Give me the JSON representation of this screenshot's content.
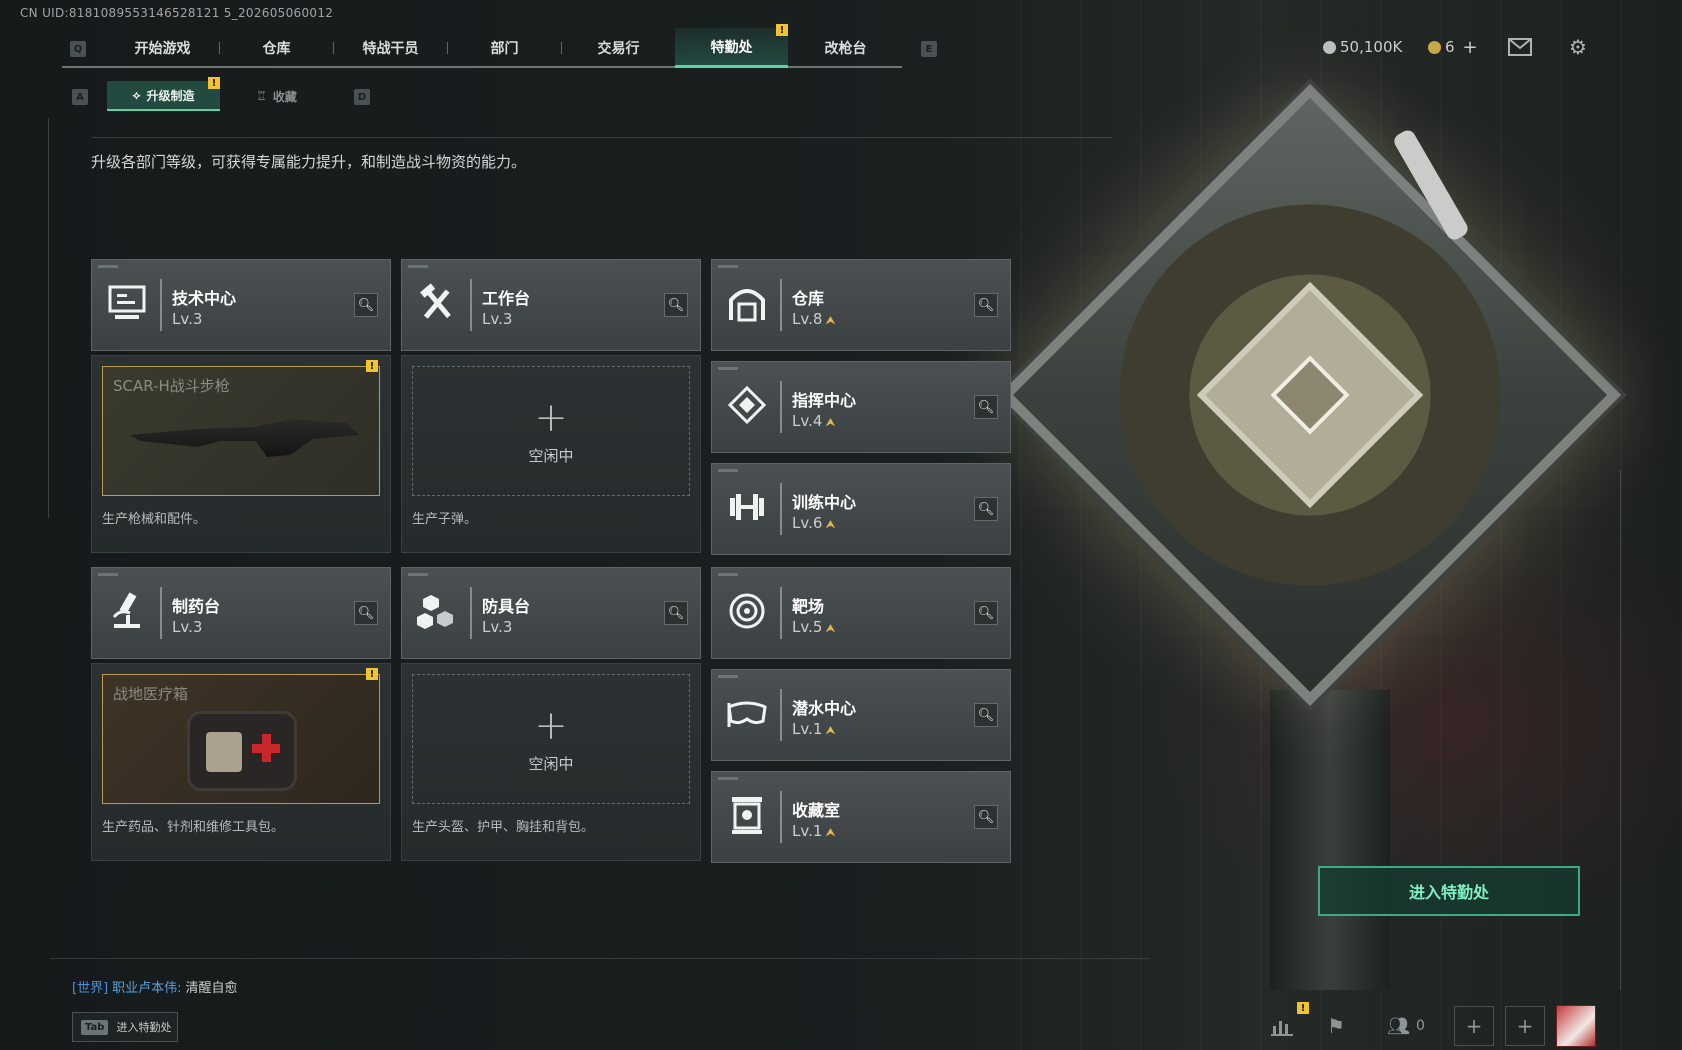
{
  "uid_text": "CN UID:8181089553146528121 5_202605060012",
  "nav": {
    "q_key": "Q",
    "e_key": "E",
    "tabs": [
      "开始游戏",
      "仓库",
      "特战干员",
      "部门",
      "交易行",
      "特勤处",
      "改枪台"
    ],
    "active_tab": "特勤处",
    "alert_mark": "!"
  },
  "currency": {
    "coins": "50,100K",
    "tokens": "6",
    "plus": "+"
  },
  "icons": {
    "mail": "mail-icon",
    "settings": "gear-icon"
  },
  "subnav": {
    "a_key": "A",
    "d_key": "D",
    "tabs": [
      "升级制造",
      "收藏"
    ],
    "active": "升级制造"
  },
  "description": "升级各部门等级，可获得专属能力提升，和制造战斗物资的能力。",
  "departments": [
    {
      "name": "技术中心",
      "level": "Lv.3",
      "icon": "monitor-icon",
      "upgradable": false
    },
    {
      "name": "工作台",
      "level": "Lv.3",
      "icon": "hammer-wrench-icon",
      "upgradable": false
    },
    {
      "name": "仓库",
      "level": "Lv.8",
      "icon": "garage-icon",
      "upgradable": true
    },
    {
      "name": "指挥中心",
      "level": "Lv.4",
      "icon": "command-chip-icon",
      "upgradable": true
    },
    {
      "name": "训练中心",
      "level": "Lv.6",
      "icon": "dumbbell-icon",
      "upgradable": true
    },
    {
      "name": "制药台",
      "level": "Lv.3",
      "icon": "microscope-icon",
      "upgradable": false
    },
    {
      "name": "防具台",
      "level": "Lv.3",
      "icon": "cubes-icon",
      "upgradable": false
    },
    {
      "name": "靶场",
      "level": "Lv.5",
      "icon": "target-icon",
      "upgradable": true
    },
    {
      "name": "潜水中心",
      "level": "Lv.1",
      "icon": "diving-mask-icon",
      "upgradable": true
    },
    {
      "name": "收藏室",
      "level": "Lv.1",
      "icon": "display-case-icon",
      "upgradable": true
    }
  ],
  "production": [
    {
      "title": "SCAR-H战斗步枪",
      "status": "filled",
      "desc": "生产枪械和配件。"
    },
    {
      "title": "",
      "status": "idle",
      "idle_text": "空闲中",
      "plus": "+",
      "desc": "生产子弹。"
    },
    {
      "title": "战地医疗箱",
      "status": "filled",
      "desc": "生产药品、针剂和维修工具包。"
    },
    {
      "title": "",
      "status": "idle",
      "idle_text": "空闲中",
      "plus": "+",
      "desc": "生产头盔、护甲、胸挂和背包。"
    }
  ],
  "enter_button": "进入特勤处",
  "chat": {
    "channel": "[世界]",
    "speaker": "职业卢本伟:",
    "message": "清醒自愈"
  },
  "tab_hint": {
    "key": "Tab",
    "label": "进入特勤处"
  },
  "bottom_bar": {
    "friends_count": "0"
  }
}
